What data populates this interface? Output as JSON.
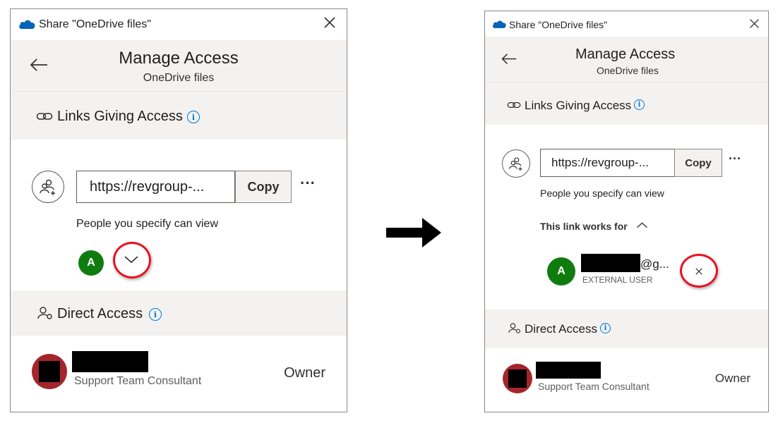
{
  "window": {
    "title": "Share \"OneDrive files\""
  },
  "header": {
    "title": "Manage Access",
    "subtitle": "OneDrive files"
  },
  "links_section": {
    "heading": "Links Giving Access",
    "url": "https://revgroup-...",
    "copy_label": "Copy",
    "more_label": "···",
    "permission_text": "People you specify can view",
    "member_initial": "A"
  },
  "link_works_for": {
    "label": "This link works for",
    "user_email_suffix": "@g...",
    "user_type": "EXTERNAL USER",
    "user_initial": "A"
  },
  "direct_access": {
    "heading": "Direct Access",
    "person_role": "Support Team Consultant",
    "person_access": "Owner"
  },
  "colors": {
    "accent": "#0078d4",
    "onedrive_blue": "#0364b8",
    "avatar_green": "#107c10",
    "owner_avatar": "#a4262c",
    "highlight_ring": "#e81123"
  }
}
